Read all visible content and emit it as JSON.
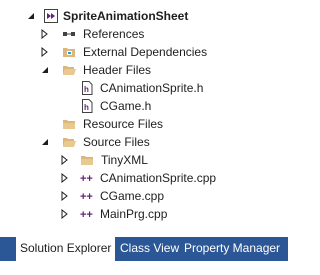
{
  "tree": {
    "solution": "SpriteAnimationSheet",
    "references": "References",
    "external_dependencies": "External Dependencies",
    "header_files": "Header Files",
    "header_items": [
      "CAnimationSprite.h",
      "CGame.h"
    ],
    "resource_files": "Resource Files",
    "source_files": "Source Files",
    "tinyxml": "TinyXML",
    "source_items": [
      "CAnimationSprite.cpp",
      "CGame.cpp",
      "MainPrg.cpp"
    ]
  },
  "tabs": [
    "Solution Explorer",
    "Class View",
    "Property Manager"
  ],
  "colors": {
    "tab_bar": "#2b5797",
    "folder": "#dcb67a",
    "cpp_icon": "#68217a",
    "header_icon": "#68217a"
  }
}
